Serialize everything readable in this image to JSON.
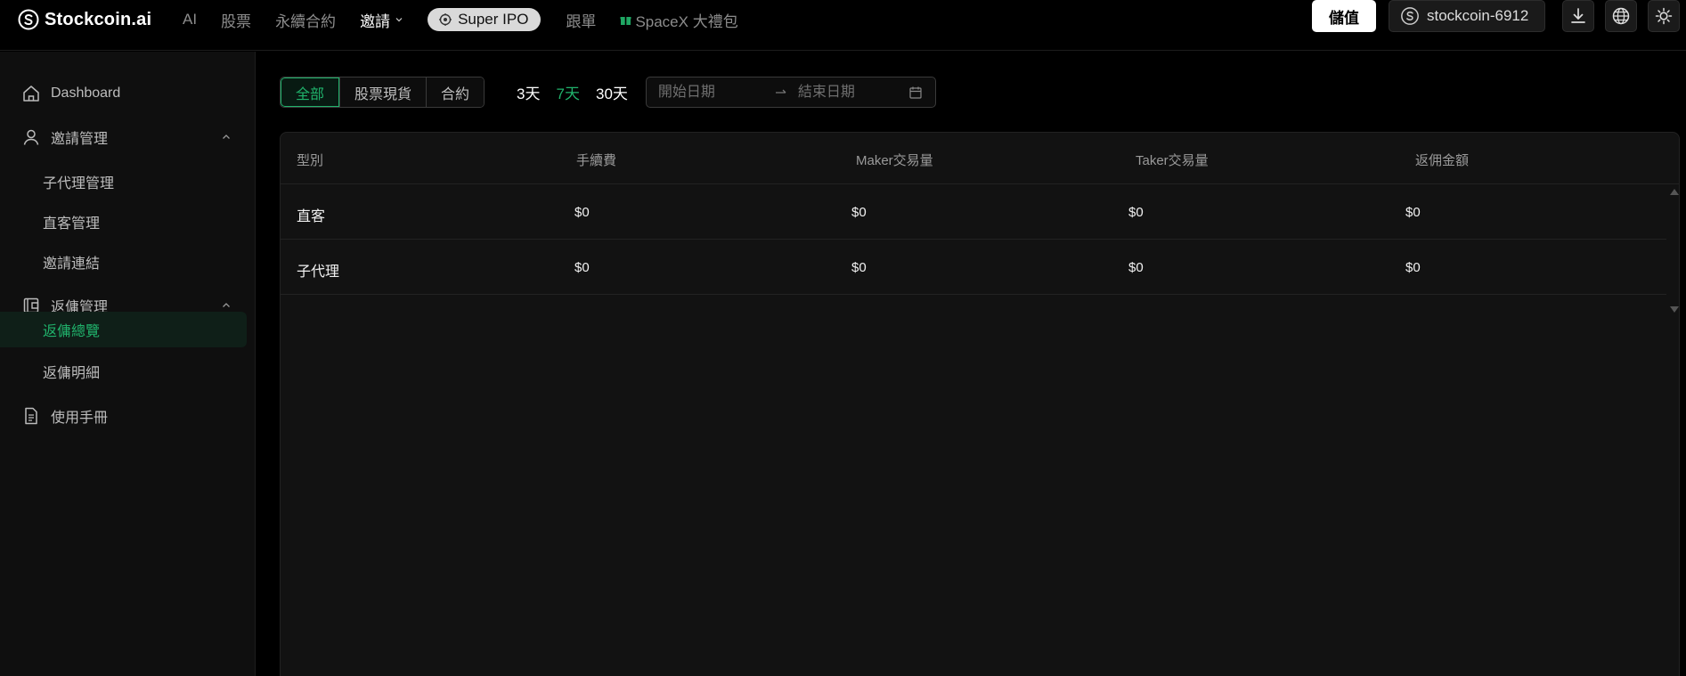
{
  "brand": {
    "name": "Stockcoin.ai"
  },
  "nav": {
    "items": [
      "AI",
      "股票",
      "永續合約",
      "邀請"
    ],
    "ipo": "Super IPO",
    "follow": "跟單",
    "promo": "SpaceX 大禮包"
  },
  "header": {
    "deposit": "儲值",
    "account": "stockcoin-6912"
  },
  "sidebar": {
    "dashboard": "Dashboard",
    "invite_group": "邀請管理",
    "invite_items": [
      "子代理管理",
      "直客管理",
      "邀請連結"
    ],
    "rebate_group": "返傭管理",
    "rebate_items": [
      "返傭總覽",
      "返傭明細"
    ],
    "manual": "使用手冊"
  },
  "filters": {
    "segments": [
      "全部",
      "股票現貨",
      "合約"
    ],
    "days": [
      "3天",
      "7天",
      "30天"
    ],
    "start_placeholder": "開始日期",
    "end_placeholder": "結束日期"
  },
  "table": {
    "columns": [
      "型別",
      "手續費",
      "Maker交易量",
      "Taker交易量",
      "返佣金額"
    ],
    "rows": [
      [
        "直客",
        "$0",
        "$0",
        "$0",
        "$0"
      ],
      [
        "子代理",
        "$0",
        "$0",
        "$0",
        "$0"
      ]
    ]
  },
  "colors": {
    "accent": "#20b26b",
    "promo": "#1fa763"
  }
}
